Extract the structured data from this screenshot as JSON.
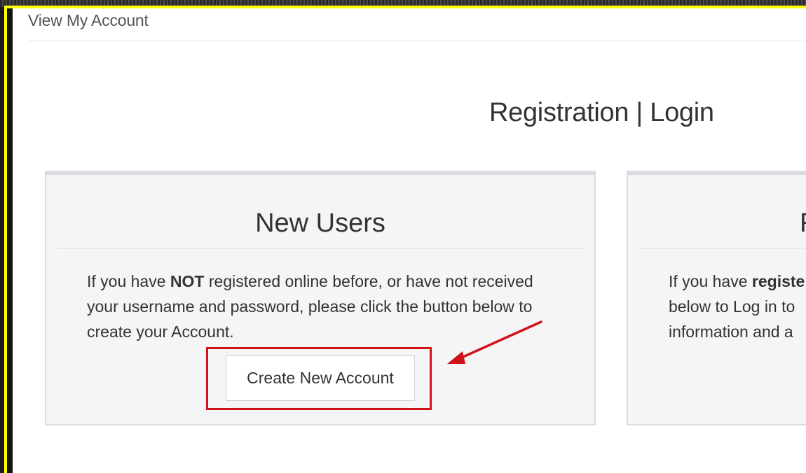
{
  "breadcrumb": "View My Account",
  "page_title": "Registration | Login",
  "new_users": {
    "title": "New Users",
    "text_before": "If you have ",
    "text_bold": "NOT",
    "text_after": " registered online before, or have not received your username and password, please click the button below to create your Account.",
    "button_label": "Create New Account"
  },
  "existing_users": {
    "title_partial": "R",
    "line1_before": "If you have ",
    "line1_bold": "registe",
    "line2": "below to Log in to",
    "line3": "information and a"
  },
  "colors": {
    "highlight_frame": "#ffff00",
    "annotation_red": "#d0121a"
  }
}
